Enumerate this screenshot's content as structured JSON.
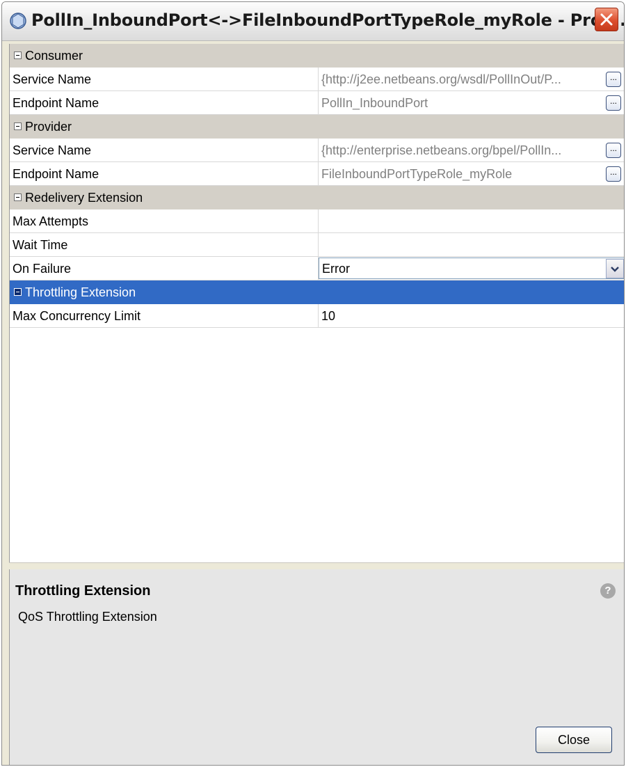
{
  "window": {
    "title": "PollIn_InboundPort<->FileInboundPortTypeRole_myRole - Prop..."
  },
  "sheet": {
    "consumer": {
      "label": "Consumer",
      "service_name": {
        "label": "Service Name",
        "value": "{http://j2ee.netbeans.org/wsdl/PollInOut/P..."
      },
      "endpoint_name": {
        "label": "Endpoint Name",
        "value": "PollIn_InboundPort"
      }
    },
    "provider": {
      "label": "Provider",
      "service_name": {
        "label": "Service Name",
        "value": "{http://enterprise.netbeans.org/bpel/PollIn..."
      },
      "endpoint_name": {
        "label": "Endpoint Name",
        "value": "FileInboundPortTypeRole_myRole"
      }
    },
    "redelivery": {
      "label": "Redelivery Extension",
      "max_attempts": {
        "label": "Max Attempts",
        "value": ""
      },
      "wait_time": {
        "label": "Wait Time",
        "value": ""
      },
      "on_failure": {
        "label": "On Failure",
        "value": "Error"
      }
    },
    "throttling": {
      "label": "Throttling Extension",
      "max_concurrency": {
        "label": "Max Concurrency Limit",
        "value": "10"
      }
    },
    "ellipsis_label": "..."
  },
  "description": {
    "title": "Throttling Extension",
    "text": "QoS Throttling Extension",
    "help_glyph": "?"
  },
  "footer": {
    "close_label": "Close"
  },
  "colors": {
    "selection": "#316ac5",
    "category_bg": "#d4d0c8",
    "readonly_text": "#808080"
  }
}
